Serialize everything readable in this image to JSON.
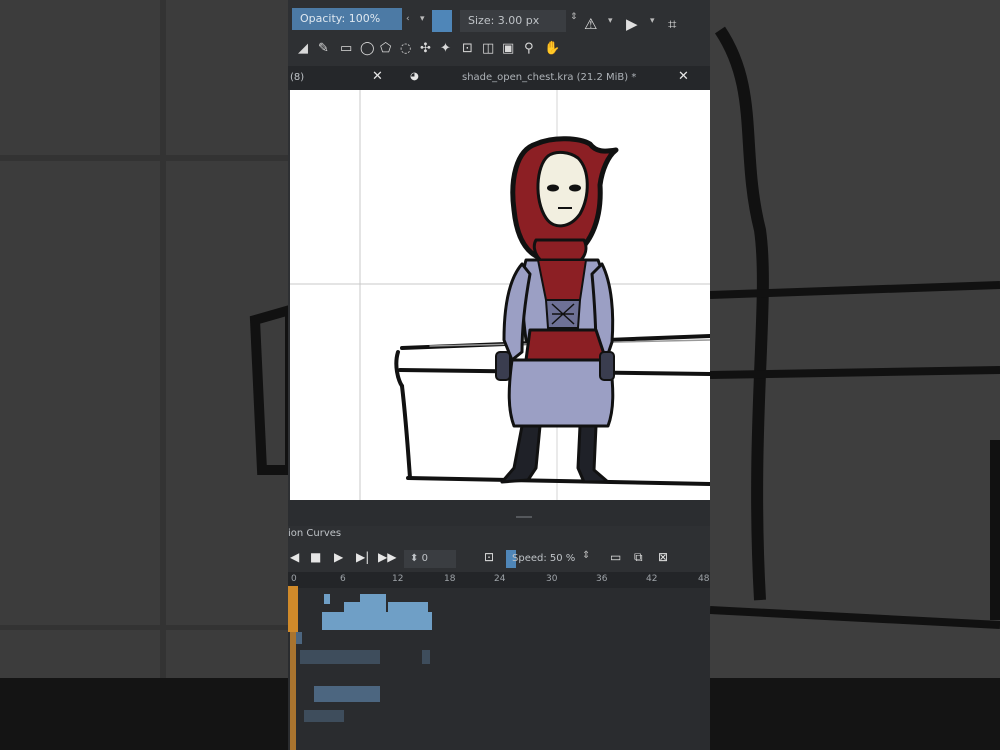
{
  "tool_options": {
    "opacity": "Opacity: 100%",
    "size": "Size: 3.00 px"
  },
  "tabs": {
    "left_partial": "(8)",
    "document": "shade_open_chest.kra (21.2 MiB) *"
  },
  "animation": {
    "dock_title": "ion Curves",
    "frame_value": "0",
    "speed": "Speed: 50 %",
    "ruler_labels": [
      "0",
      "6",
      "12",
      "18",
      "24",
      "30",
      "36",
      "42",
      "48"
    ]
  },
  "colors": {
    "accent": "#4c7aa5",
    "playhead": "#d08a2a",
    "hood_red": "#8c1f24",
    "dress_lavender": "#9b9fc4"
  }
}
